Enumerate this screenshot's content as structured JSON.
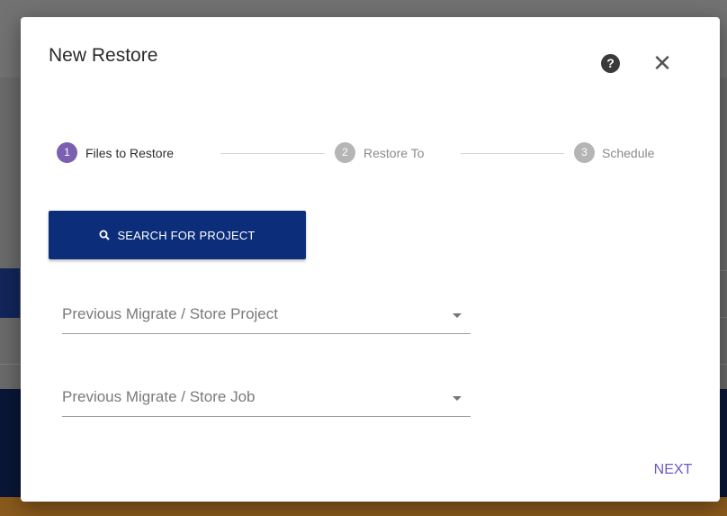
{
  "dialog": {
    "title": "New Restore",
    "help_icon_glyph": "?",
    "close_icon_glyph": "✕"
  },
  "stepper": {
    "steps": [
      {
        "number": "1",
        "label": "Files to Restore",
        "state": "active"
      },
      {
        "number": "2",
        "label": "Restore To",
        "state": "inactive"
      },
      {
        "number": "3",
        "label": "Schedule",
        "state": "inactive"
      }
    ]
  },
  "search_button": {
    "label": "SEARCH FOR PROJECT",
    "icon": "search-icon"
  },
  "fields": {
    "project_placeholder": "Previous Migrate / Store Project",
    "job_placeholder": "Previous Migrate / Store Job"
  },
  "footer": {
    "next_label": "NEXT"
  },
  "colors": {
    "accent": "#7b5fb0",
    "primary_button": "#0b2d7a",
    "inactive_step": "#b5b5b5",
    "next_link": "#6a5acd"
  }
}
